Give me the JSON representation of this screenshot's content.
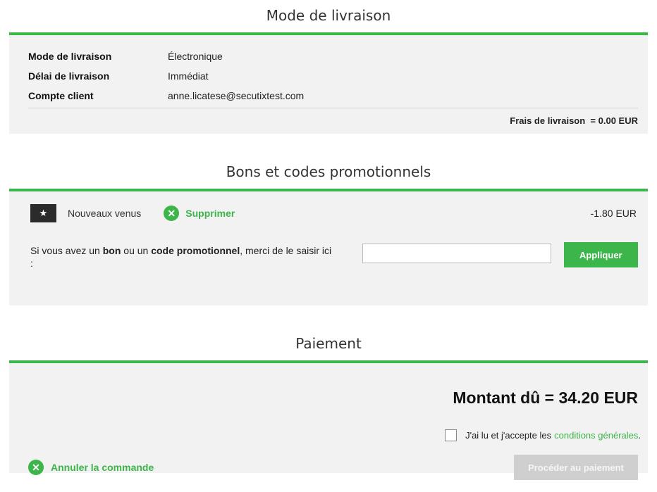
{
  "delivery": {
    "title": "Mode de livraison",
    "rows": [
      {
        "key": "Mode de livraison",
        "value": "Électronique"
      },
      {
        "key": "Délai de livraison",
        "value": "Immédiat"
      },
      {
        "key": "Compte client",
        "value": "anne.licatese@secutixtest.com"
      }
    ],
    "fee_label": "Frais de livraison",
    "fee_value": "= 0.00 EUR"
  },
  "promo": {
    "title": "Bons et codes promotionnels",
    "applied_name": "Nouveaux venus",
    "remove_label": "Supprimer",
    "applied_amount": "-1.80 EUR",
    "prompt_part1": "Si vous avez un ",
    "prompt_bold1": "bon",
    "prompt_part2": " ou un ",
    "prompt_bold2": "code promotionnel",
    "prompt_part3": ", merci de le saisir ici :",
    "input_value": "",
    "apply_label": "Appliquer"
  },
  "payment": {
    "title": "Paiement",
    "amount_due": "Montant dû = 34.20 EUR",
    "cgv_text": "J'ai lu et j'accepte les",
    "cgv_link": "conditions générales",
    "cgv_end": ".",
    "cancel_label": "Annuler la commande",
    "pay_label": "Procéder au paiement"
  },
  "icons": {
    "star": "★",
    "close": "✕"
  },
  "colors": {
    "accent": "#3cb54a",
    "panel": "#f2f2f2",
    "disabled_button": "#cfcfcf"
  }
}
